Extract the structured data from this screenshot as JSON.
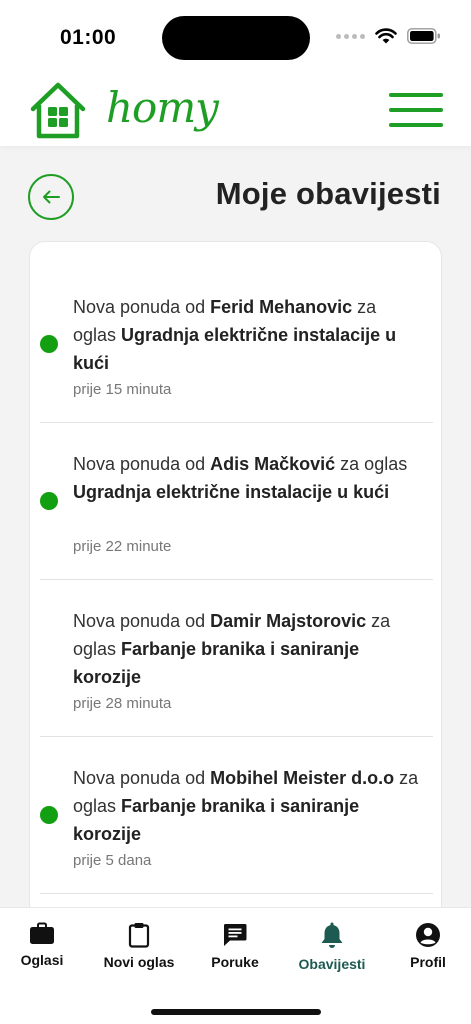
{
  "status_bar": {
    "time": "01:00"
  },
  "header": {
    "logo_text": "homy"
  },
  "page": {
    "title": "Moje obavijesti"
  },
  "notifications": [
    {
      "prefix": "Nova ponuda od ",
      "sender": "Ferid Mehanovic",
      "middle": " za oglas ",
      "listing": "Ugradnja električne instalacije u kući",
      "time": "prije 15 minuta",
      "unread": true
    },
    {
      "prefix": "Nova ponuda od ",
      "sender": "Adis Mačković",
      "middle": " za oglas ",
      "listing": "Ugradnja električne instalacije u kući",
      "time": "prije 22 minute",
      "unread": true
    },
    {
      "prefix": "Nova ponuda od ",
      "sender": "Damir Majstorovic",
      "middle": " za oglas ",
      "listing": "Farbanje branika i saniranje korozije",
      "time": "prije 28 minuta",
      "unread": false
    },
    {
      "prefix": "Nova ponuda od ",
      "sender": "Mobihel Meister d.o.o",
      "middle": " za oglas ",
      "listing": "Farbanje branika i saniranje korozije",
      "time": "prije 5 dana",
      "unread": true
    }
  ],
  "nav": {
    "items": [
      {
        "label": "Oglasi",
        "icon": "briefcase-icon"
      },
      {
        "label": "Novi oglas",
        "icon": "clipboard-icon"
      },
      {
        "label": "Poruke",
        "icon": "chat-icon"
      },
      {
        "label": "Obavijesti",
        "icon": "bell-icon",
        "active": true
      },
      {
        "label": "Profil",
        "icon": "profile-icon"
      }
    ]
  },
  "colors": {
    "brand_green": "#1e9e24",
    "unread_dot": "#12a012",
    "active_nav": "#1d5a52"
  }
}
